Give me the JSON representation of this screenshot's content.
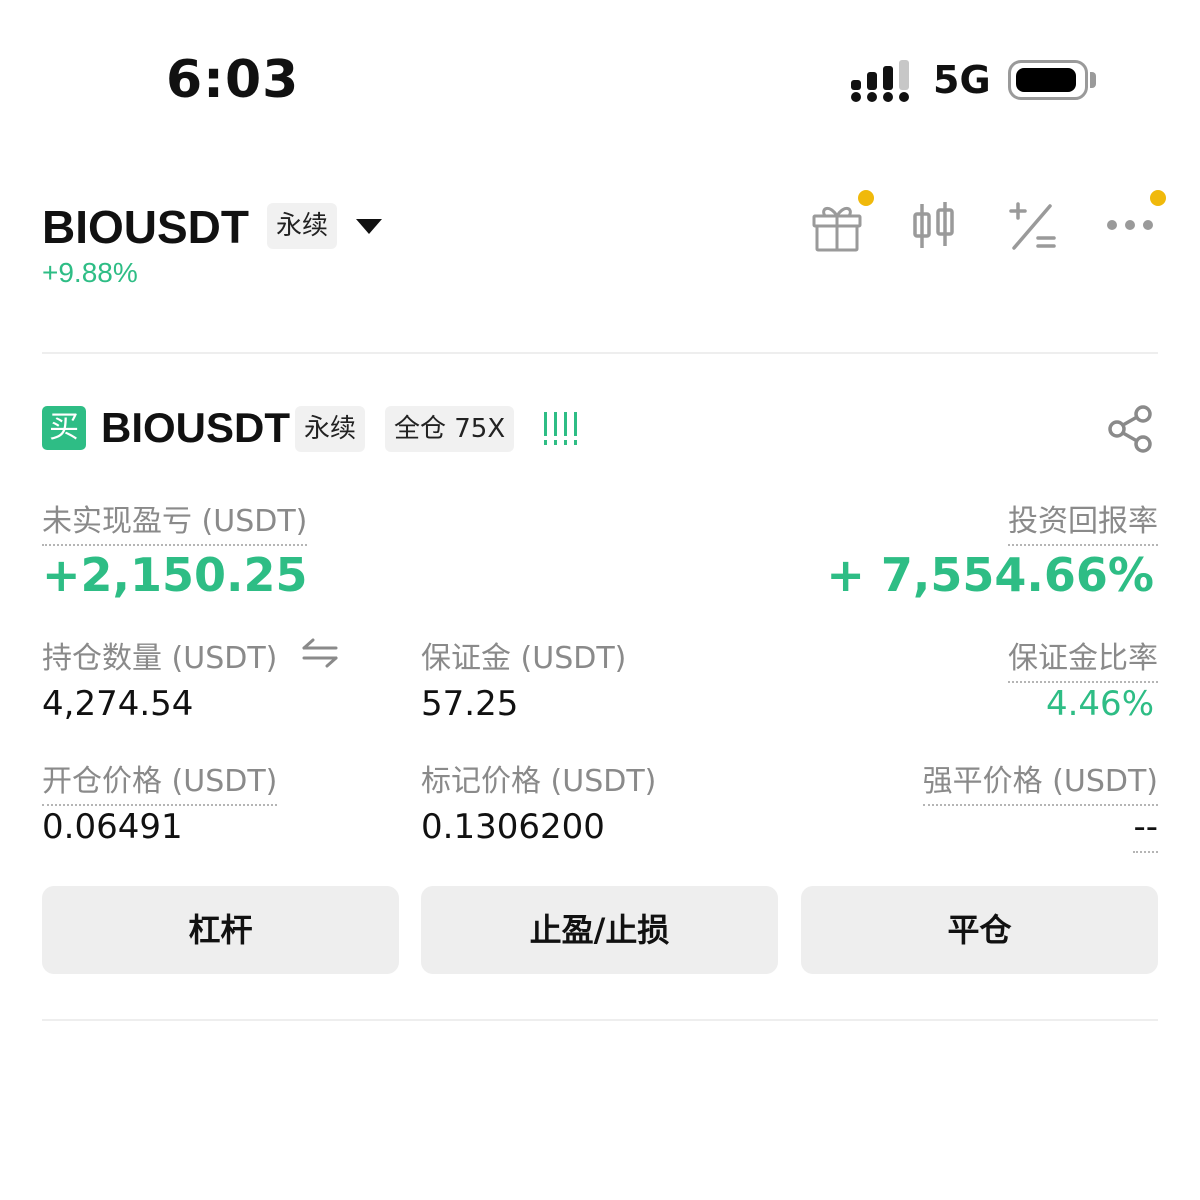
{
  "status_bar": {
    "time": "6:03",
    "network": "5G"
  },
  "header": {
    "symbol": "BIOUSDT",
    "contract_type": "永续",
    "change": "+9.88%",
    "icons": [
      "gift-icon",
      "candlestick-icon",
      "plus-minus-icon",
      "more-icon"
    ],
    "notification_color": "#f0b90b"
  },
  "position": {
    "side": "买",
    "symbol": "BIOUSDT",
    "contract_type": "永续",
    "margin_mode": "全仓 75X",
    "unrealized_pnl_label": "未实现盈亏 (USDT)",
    "unrealized_pnl": "+2,150.25",
    "roi_label": "投资回报率",
    "roi": "+ 7,554.66%",
    "size_label": "持仓数量 (USDT)",
    "size": "4,274.54",
    "margin_label": "保证金 (USDT)",
    "margin": "57.25",
    "margin_ratio_label": "保证金比率",
    "margin_ratio": "4.46%",
    "entry_price_label": "开仓价格 (USDT)",
    "entry_price": "0.06491",
    "mark_price_label": "标记价格 (USDT)",
    "mark_price": "0.1306200",
    "liq_price_label": "强平价格 (USDT)",
    "liq_price": "--"
  },
  "actions": {
    "leverage": "杠杆",
    "tp_sl": "止盈/止损",
    "close": "平仓"
  },
  "colors": {
    "green": "#2ebd85",
    "accent": "#f0b90b"
  }
}
